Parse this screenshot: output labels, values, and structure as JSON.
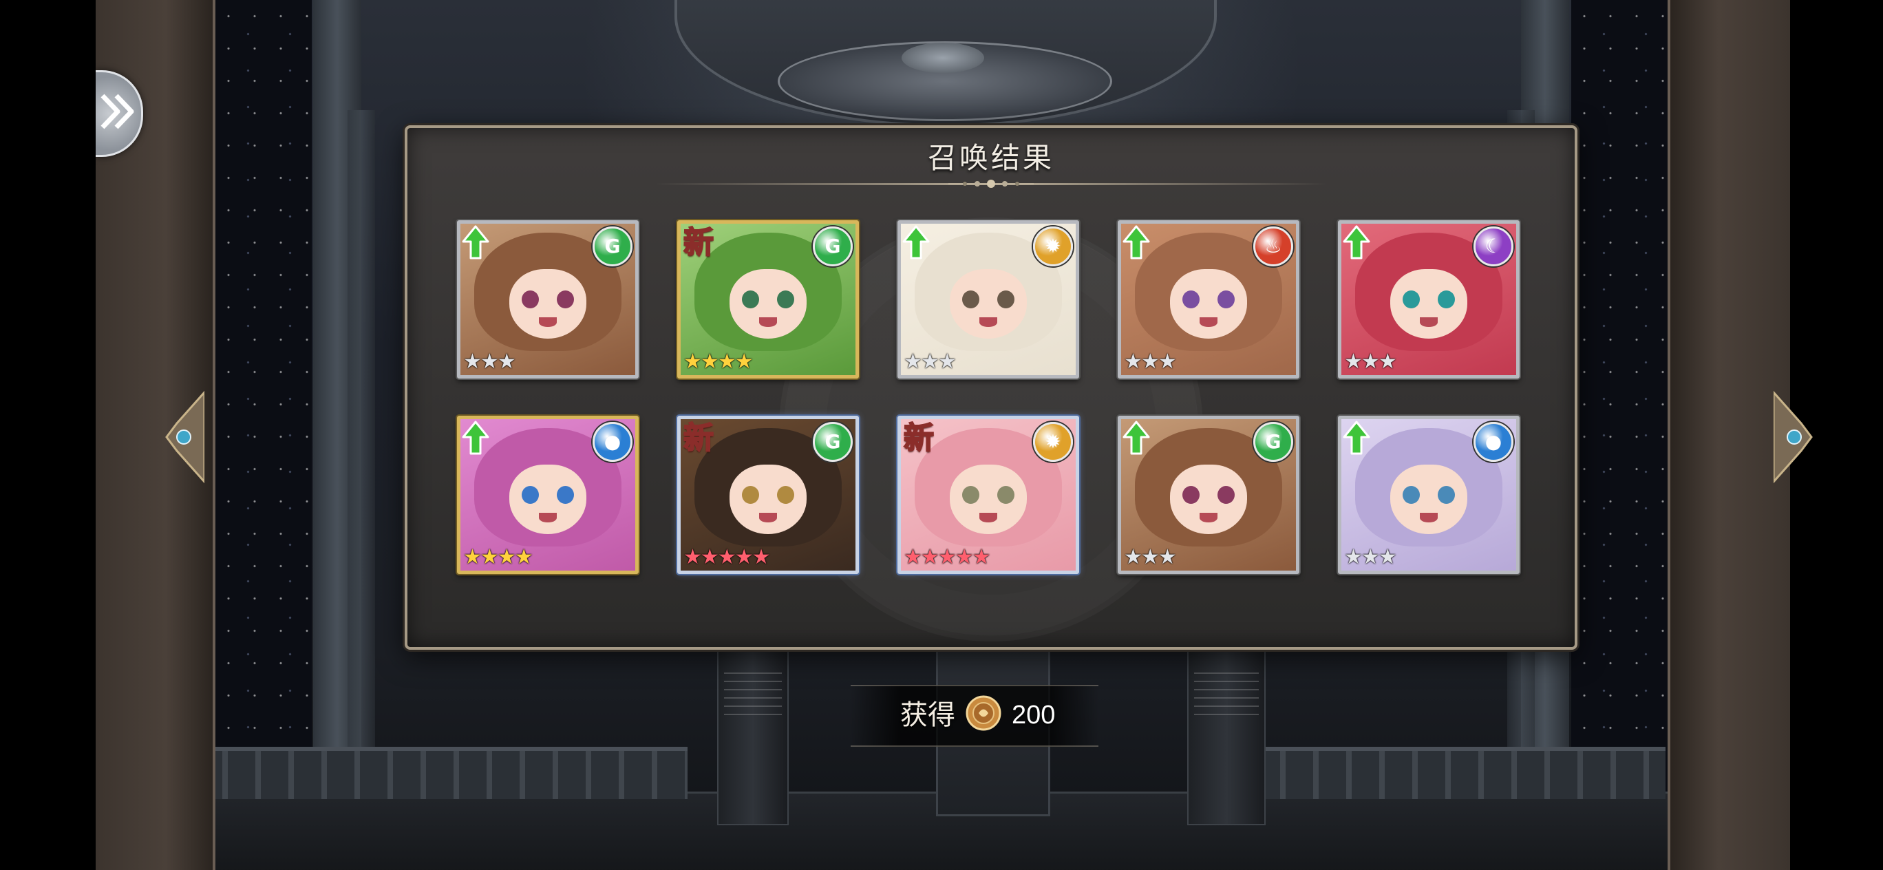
{
  "dialog": {
    "title": "召唤结果"
  },
  "cards": [
    {
      "badge": "up",
      "element": "wind",
      "rarity": 3,
      "star_color": "silver",
      "frame": "silver"
    },
    {
      "badge": "new",
      "badge_text": "新",
      "element": "wind",
      "rarity": 4,
      "star_color": "gold",
      "frame": "gold"
    },
    {
      "badge": "up",
      "element": "light",
      "rarity": 3,
      "star_color": "silver",
      "frame": "silver"
    },
    {
      "badge": "up",
      "element": "fire",
      "rarity": 3,
      "star_color": "silver",
      "frame": "silver"
    },
    {
      "badge": "up",
      "element": "dark",
      "rarity": 3,
      "star_color": "silver",
      "frame": "silver"
    },
    {
      "badge": "up",
      "element": "water",
      "rarity": 4,
      "star_color": "gold",
      "frame": "gold"
    },
    {
      "badge": "new",
      "badge_text": "新",
      "element": "wind",
      "rarity": 5,
      "star_color": "red",
      "frame": "rainbow"
    },
    {
      "badge": "new",
      "badge_text": "新",
      "element": "light",
      "rarity": 5,
      "star_color": "red",
      "frame": "rainbow"
    },
    {
      "badge": "up",
      "element": "wind",
      "rarity": 3,
      "star_color": "silver",
      "frame": "silver"
    },
    {
      "badge": "up",
      "element": "water",
      "rarity": 3,
      "star_color": "silver",
      "frame": "silver"
    }
  ],
  "reward": {
    "label": "获得",
    "value": "200",
    "icon": "coin-icon"
  },
  "colors": {
    "wind": "#2fae4b",
    "light": "#e0a12a",
    "fire": "#d5402a",
    "dark": "#8d3fc4",
    "water": "#2b7fd4",
    "up_arrow": "#3ec43a",
    "frame_gold": "#d8b75b",
    "frame_silver": "#b7b9bf"
  },
  "nav": {
    "icon": "double-chevron-right-icon"
  }
}
